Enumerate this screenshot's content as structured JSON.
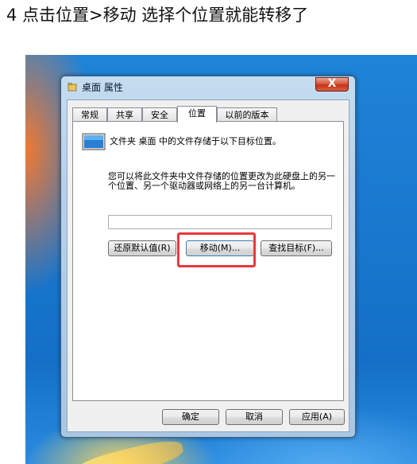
{
  "caption": "4 点击位置>移动  选择个位置就能转移了",
  "window": {
    "title": "桌面 属性",
    "close_symbol": "X"
  },
  "tabs": [
    {
      "label": "常规",
      "active": false
    },
    {
      "label": "共享",
      "active": false
    },
    {
      "label": "安全",
      "active": false
    },
    {
      "label": "位置",
      "active": true
    },
    {
      "label": "以前的版本",
      "active": false
    }
  ],
  "location_tab": {
    "description": "文件夹 桌面 中的文件存储于以下目标位置。",
    "body": "您可以将此文件夹中文件存储的位置更改为此硬盘上的另一个位置、另一个驱动器或网络上的另一台计算机。",
    "path_value": "",
    "restore_default_label": "还原默认值(R)",
    "move_label": "移动(M)...",
    "find_target_label": "查找目标(F)..."
  },
  "footer": {
    "ok_label": "确定",
    "cancel_label": "取消",
    "apply_label": "应用(A)"
  },
  "colors": {
    "highlight": "#e8393f",
    "desktop_blue": "#1a78cf"
  },
  "icons": {
    "title": "folder-properties-icon",
    "folder": "desktop-folder-icon"
  }
}
